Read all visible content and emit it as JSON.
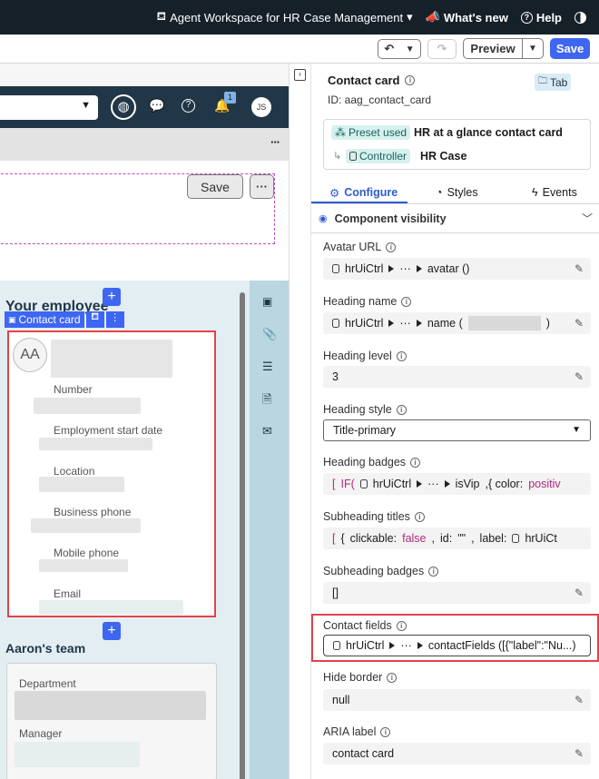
{
  "topbar": {
    "workspace": "Agent Workspace for HR Case Management",
    "whats_new": "What's new",
    "help": "Help"
  },
  "toolbar": {
    "preview": "Preview",
    "save": "Save"
  },
  "canvas": {
    "form_save": "Save",
    "more": "···",
    "notification_count": "1",
    "avatar_initials": "JS",
    "section_title": "Your employee",
    "card_toolbar_label": "Contact card",
    "card_avatar": "AA",
    "fields": [
      "Number",
      "Employment start date",
      "Location",
      "Business phone",
      "Mobile phone",
      "Email"
    ],
    "team_title": "Aaron's team",
    "team_fields": [
      "Department",
      "Manager"
    ]
  },
  "panel": {
    "title": "Contact card",
    "tab_badge": "Tab",
    "id_label": "ID: aag_contact_card",
    "preset_chip": "Preset used",
    "preset_value": "HR at a glance contact card",
    "controller_chip": "Controller",
    "controller_value": "HR Case",
    "tabs": [
      "Configure",
      "Styles",
      "Events"
    ],
    "section": "Component visibility",
    "props": [
      {
        "label": "Avatar URL",
        "value": "avatar ()"
      },
      {
        "label": "Heading name",
        "value": "name ("
      },
      {
        "label": "Heading level",
        "value": "3"
      },
      {
        "label": "Heading style",
        "value": "Title-primary"
      },
      {
        "label": "Heading badges",
        "value": "isVip"
      },
      {
        "label": "Subheading titles",
        "value": ""
      },
      {
        "label": "Subheading badges",
        "value": "[]"
      },
      {
        "label": "Contact fields",
        "value": "contactFields ([{\"label\":\"Nu...)"
      },
      {
        "label": "Hide border",
        "value": "null"
      },
      {
        "label": "ARIA label",
        "value": "contact card"
      }
    ],
    "ctrl": "hrUiCtrl",
    "ellipsis": "···",
    "badge_if": "IF(",
    "badge_color": ",{  color:",
    "badge_positive": "positiv",
    "sub_clickable": "clickable:",
    "sub_false": "false",
    "sub_id": "id:",
    "sub_id_val": "\"\"",
    "sub_label": "label:",
    "sub_ctrl": "hrUiCt",
    "bracket_open": "[",
    "brace_open": "{"
  },
  "colors": {
    "topbar": "#162029",
    "accent": "#3e66f2",
    "highlight": "#e2424b"
  }
}
